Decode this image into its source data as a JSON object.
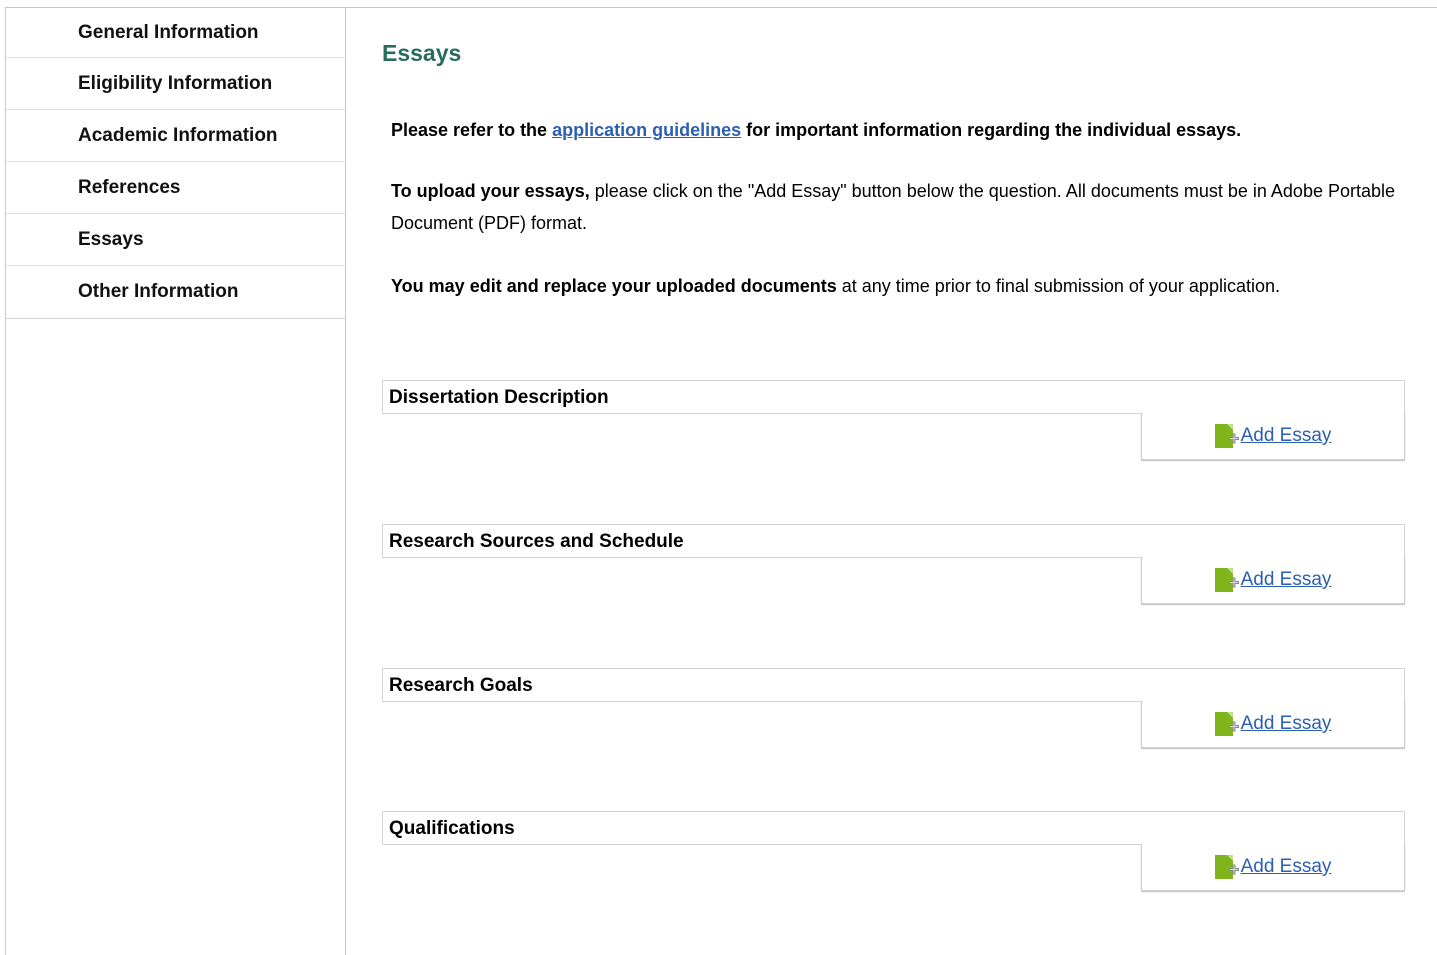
{
  "sidebar": {
    "items": [
      {
        "label": "General Information"
      },
      {
        "label": "Eligibility Information"
      },
      {
        "label": "Academic Information"
      },
      {
        "label": "References"
      },
      {
        "label": "Essays"
      },
      {
        "label": "Other Information"
      }
    ]
  },
  "main": {
    "title": "Essays",
    "intro": {
      "p1_prefix": "Please refer to the ",
      "p1_link": "application guidelines",
      "p1_suffix": " for important information regarding the individual essays.",
      "p2_bold": "To upload your essays,",
      "p2_text": " please click on the \"Add Essay\" button below the question. All documents must be in Adobe Portable Document (PDF) format.",
      "p3_bold": "You may edit and replace your uploaded documents",
      "p3_text": " at any time prior to final submission of your application."
    },
    "sections": [
      {
        "title": "Dissertation Description",
        "button_label": "Add Essay"
      },
      {
        "title": "Research Sources and Schedule",
        "button_label": "Add Essay"
      },
      {
        "title": "Research Goals",
        "button_label": "Add Essay"
      },
      {
        "title": "Qualifications",
        "button_label": "Add Essay"
      }
    ],
    "button_icon": "add-document-icon",
    "colors": {
      "title": "#2a6b5f",
      "link": "#2b5fb4",
      "icon_green": "#7fb51b"
    }
  }
}
